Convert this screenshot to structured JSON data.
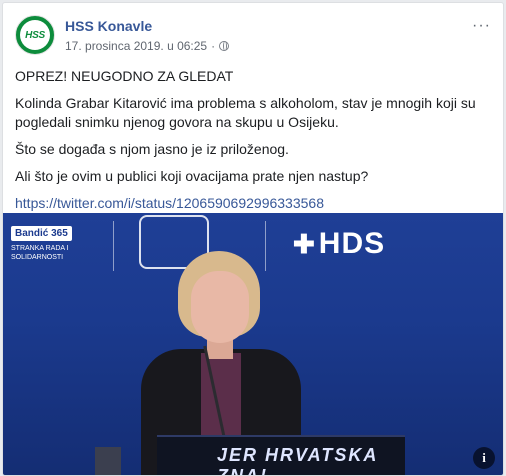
{
  "post": {
    "page_name": "HSS Konavle",
    "avatar_text": "HSS",
    "timestamp": "17. prosinca 2019. u 06:25",
    "separator": "·",
    "more_label": "···",
    "paragraphs": [
      "OPREZ! NEUGODNO ZA GLEDAT",
      "Kolinda Grabar Kitarović ima problema s alkoholom, stav je mnogih koji su pogledali snimku njenog govora na skupu u Osijeku.",
      "Što se događa s njom jasno je iz priloženog.",
      "Ali što je ovim u publici koji ovacijama prate njen nastup?"
    ],
    "link": "https://twitter.com/i/status/1206590692996333568"
  },
  "media": {
    "bandic_label": "Bandić 365",
    "bandic_sub": "STRANKA RADA I SOLIDARNOSTI",
    "hds_label": "HDS",
    "hds_cross": "✚",
    "podium_text": "JER HRVATSKA ZNA!",
    "info_label": "i"
  },
  "colors": {
    "link": "#385898",
    "stage_blue": "#1f3f96",
    "hss_green": "#0d8c3c"
  },
  "icons": {
    "globe": "globe-icon",
    "more": "more-icon",
    "info": "info-icon"
  }
}
